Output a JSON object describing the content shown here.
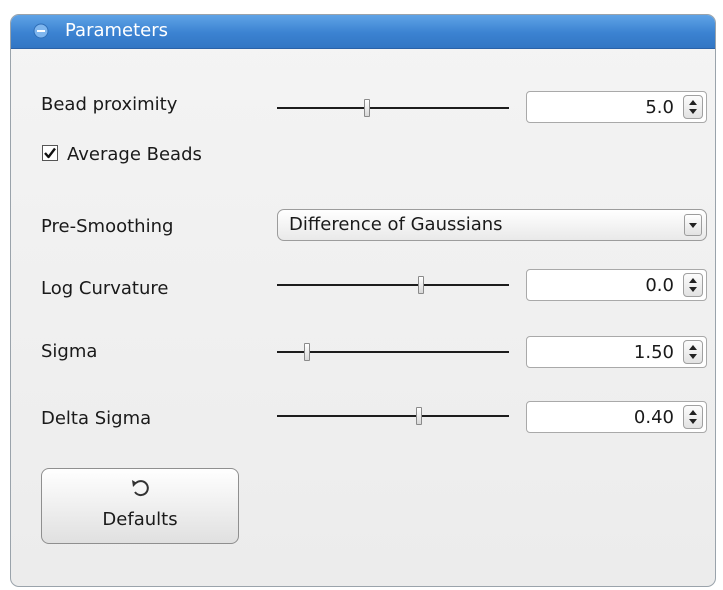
{
  "panel": {
    "title": "Parameters"
  },
  "bead_proximity": {
    "label": "Bead proximity",
    "value": "5.0",
    "slider_fraction": 0.39
  },
  "average_beads": {
    "label": "Average Beads",
    "checked": true
  },
  "pre_smoothing": {
    "label": "Pre-Smoothing",
    "selected": "Difference of Gaussians"
  },
  "log_curvature": {
    "label": "Log Curvature",
    "value": "0.0",
    "slider_fraction": 0.62
  },
  "sigma": {
    "label": "Sigma",
    "value": "1.50",
    "slider_fraction": 0.13
  },
  "delta_sigma": {
    "label": "Delta Sigma",
    "value": "0.40",
    "slider_fraction": 0.61
  },
  "defaults_button": {
    "label": "Defaults",
    "icon": "undo-icon"
  },
  "colors": {
    "header": "#3b82d1",
    "panel_background": "#efefef"
  }
}
